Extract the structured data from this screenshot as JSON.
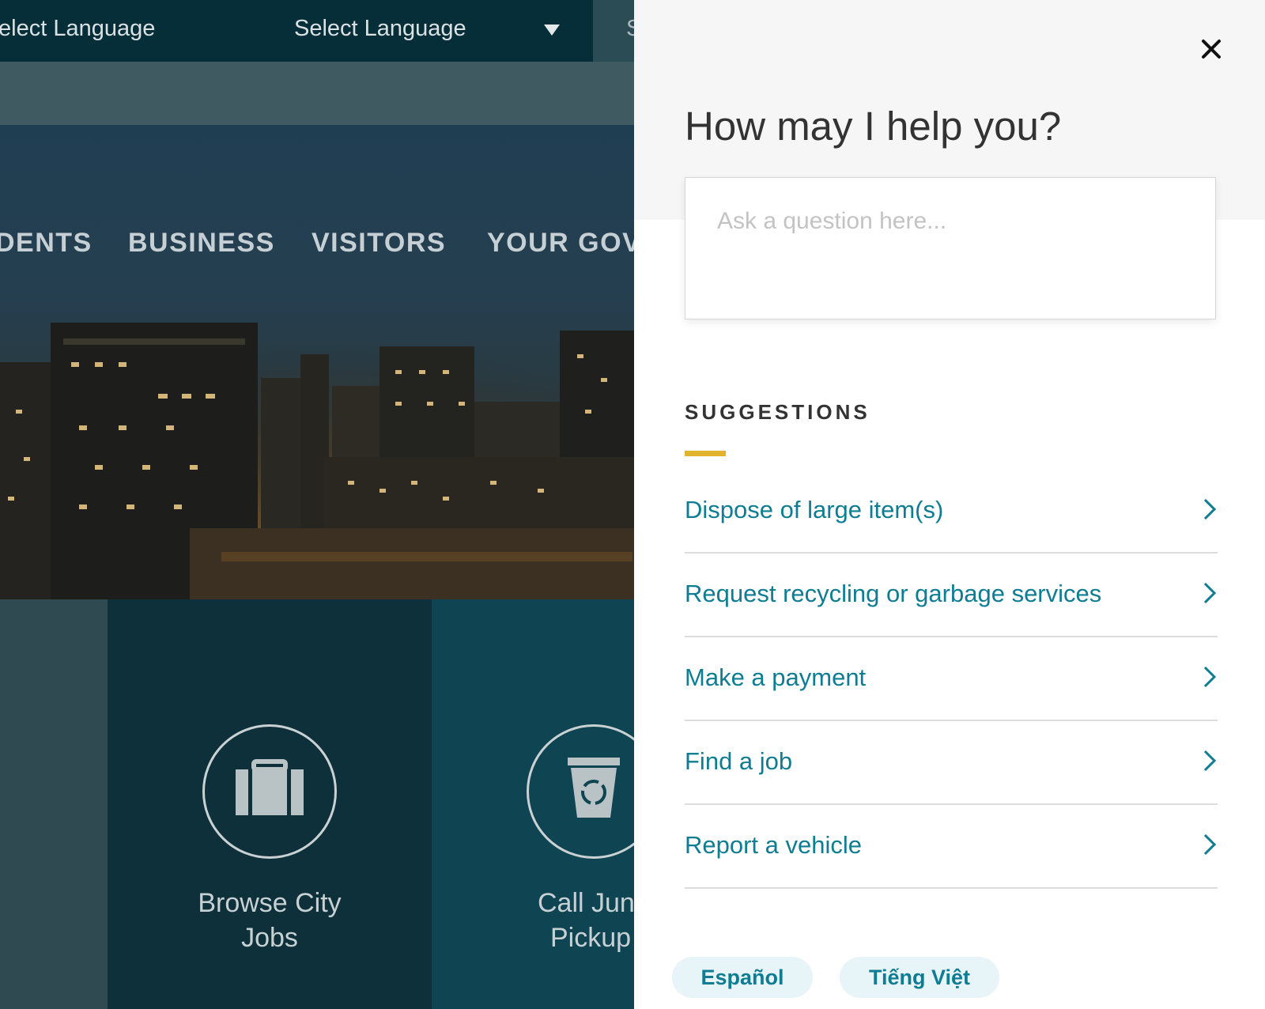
{
  "topbar": {
    "language_left": "elect Language",
    "language_select": "Select Language",
    "partial_segment": "S"
  },
  "nav": {
    "items": [
      "DENTS",
      "BUSINESS",
      "VISITORS",
      "YOUR GOV"
    ]
  },
  "tiles": {
    "browse_jobs_line1": "Browse City",
    "browse_jobs_line2": "Jobs",
    "junk_line1": "Call Jun",
    "junk_line2": "Pickup"
  },
  "help_panel": {
    "title": "How may I help you?",
    "question_placeholder": "Ask a question here...",
    "suggestions_title": "SUGGESTIONS",
    "suggestions": [
      {
        "label": "Dispose of large item(s)"
      },
      {
        "label": "Request recycling or garbage services"
      },
      {
        "label": "Make a payment"
      },
      {
        "label": "Find a job"
      },
      {
        "label": "Report a vehicle"
      }
    ],
    "languages": [
      "Español",
      "Tiếng Việt"
    ]
  },
  "colors": {
    "accent_link": "#0e7d93",
    "underline_gold": "#e2b32c",
    "topbar_bg": "#062e38",
    "tile_dark": "#0e303a"
  },
  "icons": [
    "close-icon",
    "chevron-right-icon",
    "briefcase-icon",
    "recycle-bin-icon",
    "dropdown-caret-icon"
  ]
}
